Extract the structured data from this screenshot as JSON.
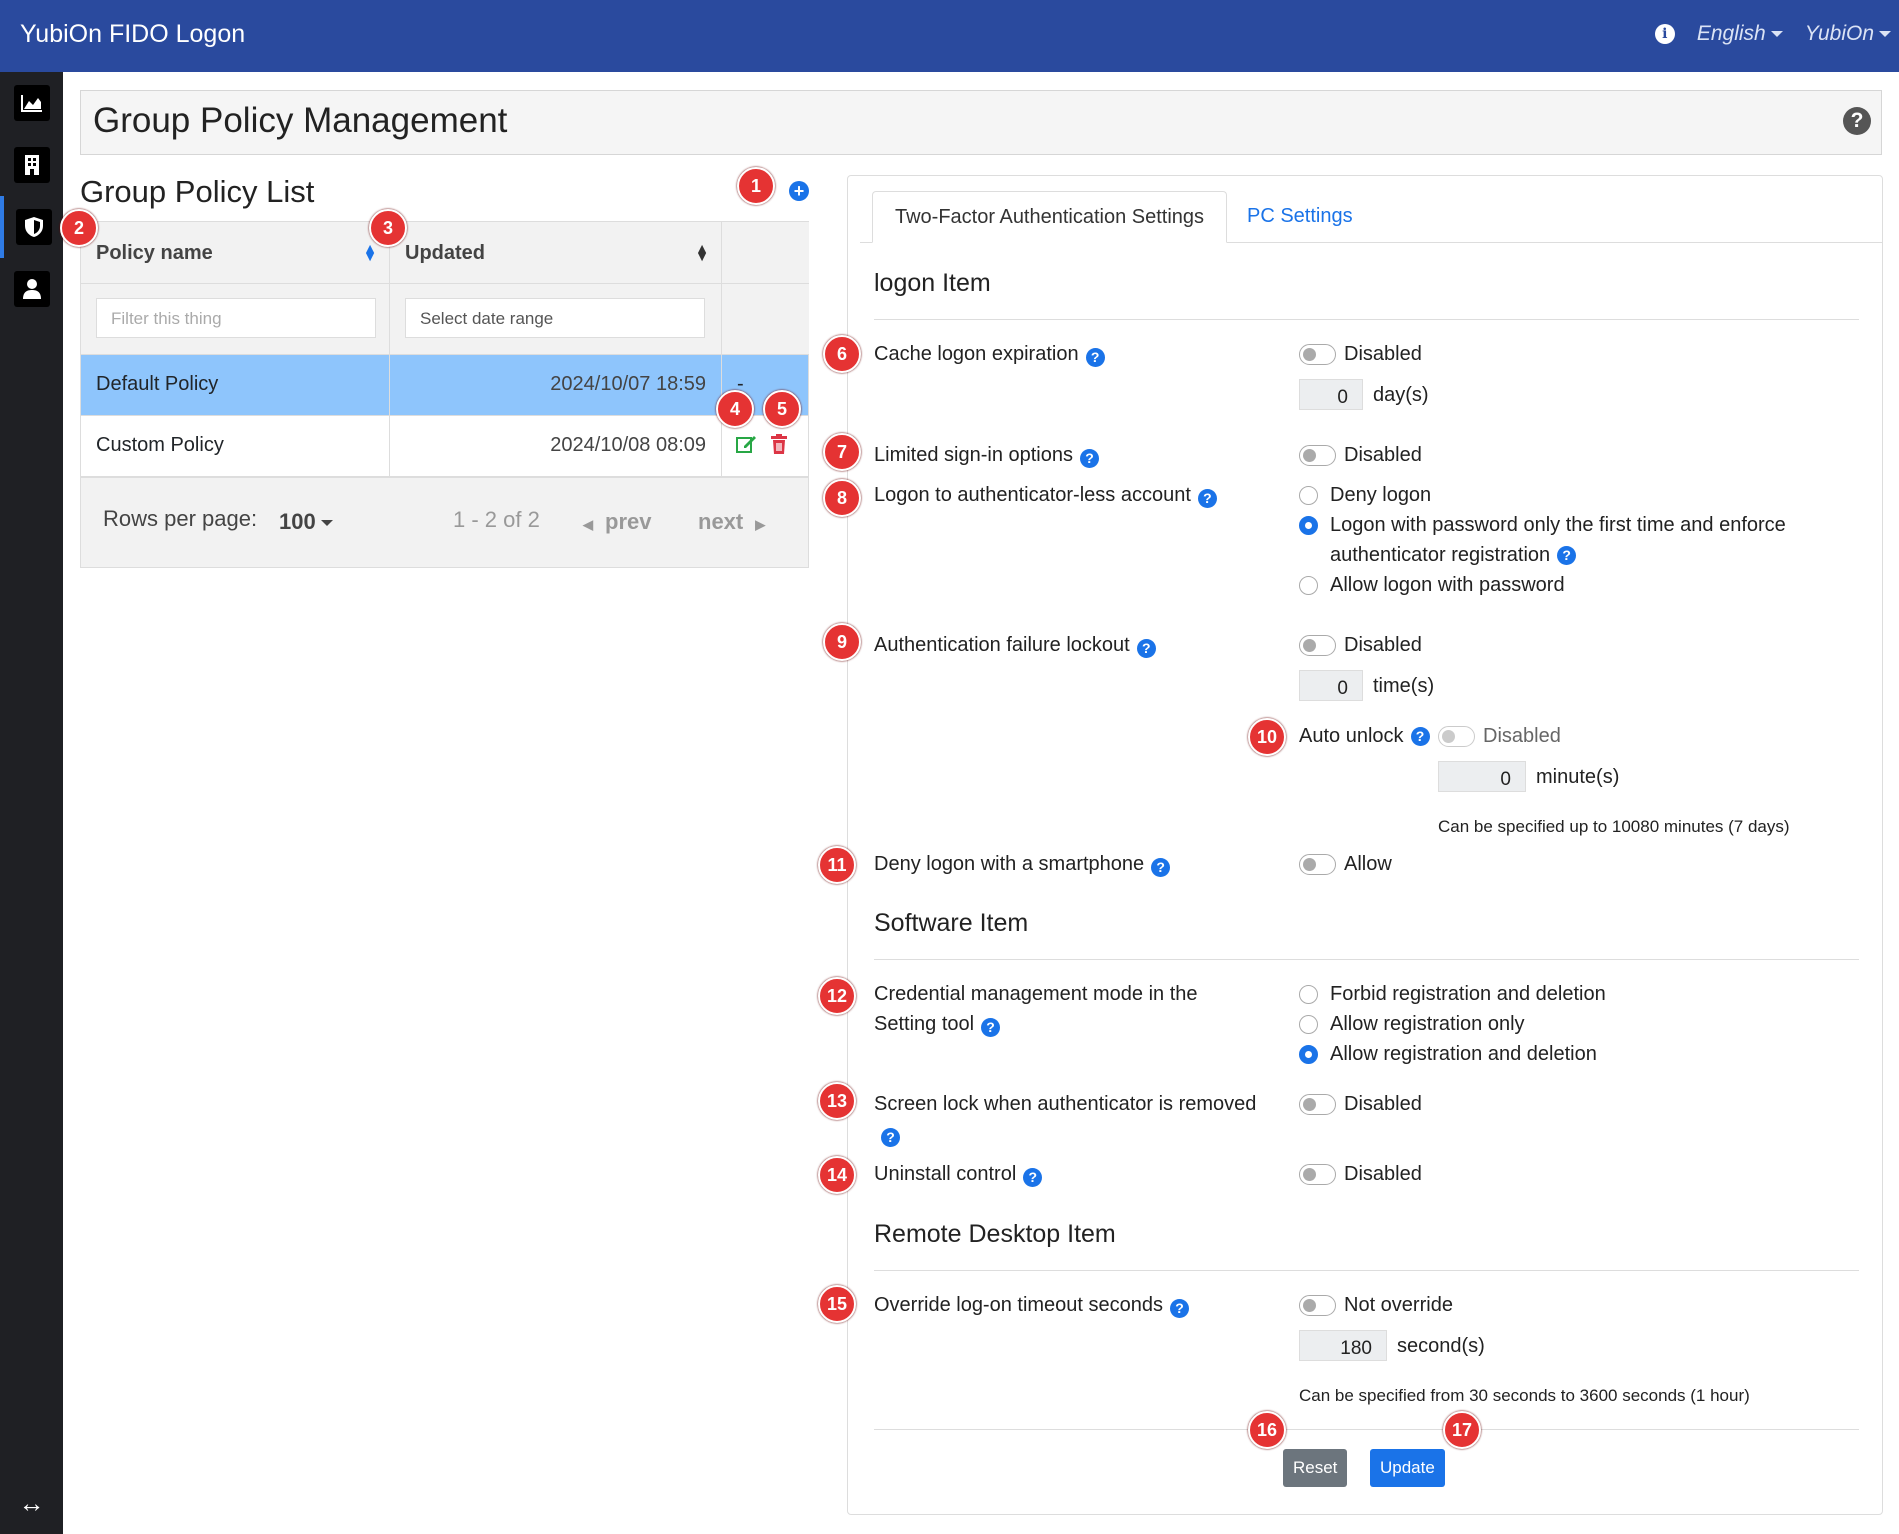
{
  "topbar": {
    "brand": "YubiOn FIDO Logon",
    "language": "English",
    "user": "YubiOn"
  },
  "sidebar": {
    "items": [
      "chart-icon",
      "building-icon",
      "shield-icon",
      "user-icon"
    ],
    "collapse_icon": "↔"
  },
  "page": {
    "title": "Group Policy Management"
  },
  "list": {
    "title": "Group Policy List",
    "columns": {
      "name": "Policy name",
      "updated": "Updated"
    },
    "filter_placeholder": "Filter this thing",
    "date_placeholder": "Select date range",
    "rows": [
      {
        "name": "Default Policy",
        "updated": "2024/10/07 18:59",
        "actions": "-"
      },
      {
        "name": "Custom Policy",
        "updated": "2024/10/08 08:09",
        "actions": ""
      }
    ],
    "pager": {
      "rows_label": "Rows per page:",
      "rows_value": "100",
      "range": "1 - 2 of 2",
      "prev": "prev",
      "next": "next"
    }
  },
  "tabs": {
    "two_factor": "Two-Factor Authentication Settings",
    "pc": "PC Settings"
  },
  "sections": {
    "logon": "logon Item",
    "software": "Software Item",
    "remote": "Remote Desktop Item"
  },
  "settings": {
    "cache": {
      "label": "Cache logon expiration",
      "state": "Disabled",
      "value": "0",
      "unit": "day(s)"
    },
    "limited": {
      "label": "Limited sign-in options",
      "state": "Disabled"
    },
    "authless": {
      "label": "Logon to authenticator-less account",
      "opt1": "Deny logon",
      "opt2a": "Logon with password only the first time and enforce",
      "opt2b": "authenticator registration",
      "opt3": "Allow logon with password"
    },
    "lockout": {
      "label": "Authentication failure lockout",
      "state": "Disabled",
      "value": "0",
      "unit": "time(s)"
    },
    "autounlock": {
      "label": "Auto unlock",
      "state": "Disabled",
      "value": "0",
      "unit": "minute(s)",
      "note": "Can be specified up to 10080 minutes (7 days)"
    },
    "smartphone": {
      "label": "Deny logon with a smartphone",
      "state": "Allow"
    },
    "credmode": {
      "label1": "Credential management mode in the",
      "label2": "Setting tool",
      "opt1": "Forbid registration and deletion",
      "opt2": "Allow registration only",
      "opt3": "Allow registration and deletion"
    },
    "screenlock": {
      "label": "Screen lock when authenticator is removed",
      "state": "Disabled"
    },
    "uninstall": {
      "label": "Uninstall control",
      "state": "Disabled"
    },
    "timeout": {
      "label": "Override log-on timeout seconds",
      "state": "Not override",
      "value": "180",
      "unit": "second(s)",
      "note": "Can be specified from 30 seconds to 3600 seconds (1 hour)"
    }
  },
  "buttons": {
    "reset": "Reset",
    "update": "Update"
  },
  "badges": [
    "1",
    "2",
    "3",
    "4",
    "5",
    "6",
    "7",
    "8",
    "9",
    "10",
    "11",
    "12",
    "13",
    "14",
    "15",
    "16",
    "17"
  ],
  "colors": {
    "topbar": "#2a4a9e",
    "sidebar": "#1f2024",
    "selected_row": "#8ec5fc",
    "badge": "#e53333",
    "primary": "#1a73e8",
    "reset": "#6c757d",
    "edit": "#28a745",
    "delete": "#dc3545"
  }
}
